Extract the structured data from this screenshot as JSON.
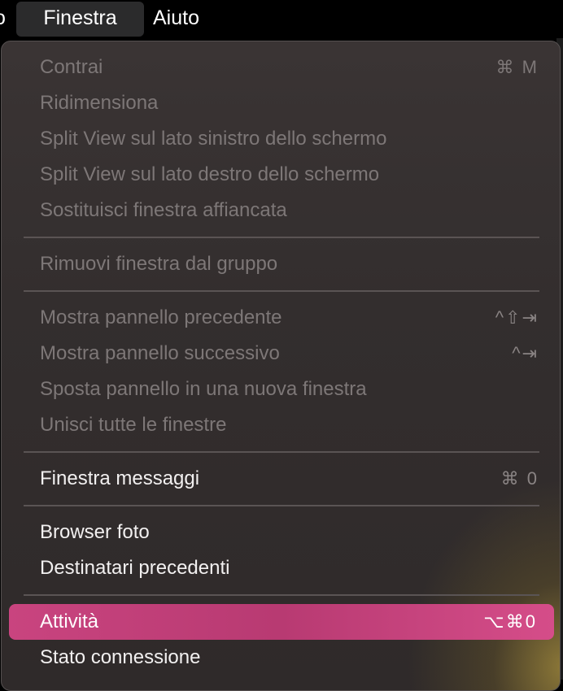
{
  "menubar": {
    "prev_fragment": "o",
    "finestra": "Finestra",
    "aiuto": "Aiuto"
  },
  "menu": {
    "items": [
      {
        "label": "Contrai",
        "shortcut": "⌘ M",
        "enabled": false
      },
      {
        "label": "Ridimensiona",
        "shortcut": "",
        "enabled": false
      },
      {
        "label": "Split View sul lato sinistro dello schermo",
        "shortcut": "",
        "enabled": false
      },
      {
        "label": "Split View sul lato destro dello schermo",
        "shortcut": "",
        "enabled": false
      },
      {
        "label": "Sostituisci finestra affiancata",
        "shortcut": "",
        "enabled": false
      },
      {
        "label": "Rimuovi finestra dal gruppo",
        "shortcut": "",
        "enabled": false
      },
      {
        "label": "Mostra pannello precedente",
        "shortcut": "^⇧⇥",
        "enabled": false
      },
      {
        "label": "Mostra pannello successivo",
        "shortcut": "^⇥",
        "enabled": false
      },
      {
        "label": "Sposta pannello in una nuova finestra",
        "shortcut": "",
        "enabled": false
      },
      {
        "label": "Unisci tutte le finestre",
        "shortcut": "",
        "enabled": false
      },
      {
        "label": "Finestra messaggi",
        "shortcut": "⌘ 0",
        "enabled": true
      },
      {
        "label": "Browser foto",
        "shortcut": "",
        "enabled": true
      },
      {
        "label": "Destinatari precedenti",
        "shortcut": "",
        "enabled": true
      },
      {
        "label": "Attività",
        "shortcut": "⌥⌘0",
        "enabled": true,
        "highlighted": true
      },
      {
        "label": "Stato connessione",
        "shortcut": "",
        "enabled": true
      }
    ]
  },
  "colors": {
    "highlight": "#c9447f",
    "menu_bg": "#342f2f",
    "text_enabled": "#f2f0f0",
    "text_disabled": "#7d7777"
  }
}
